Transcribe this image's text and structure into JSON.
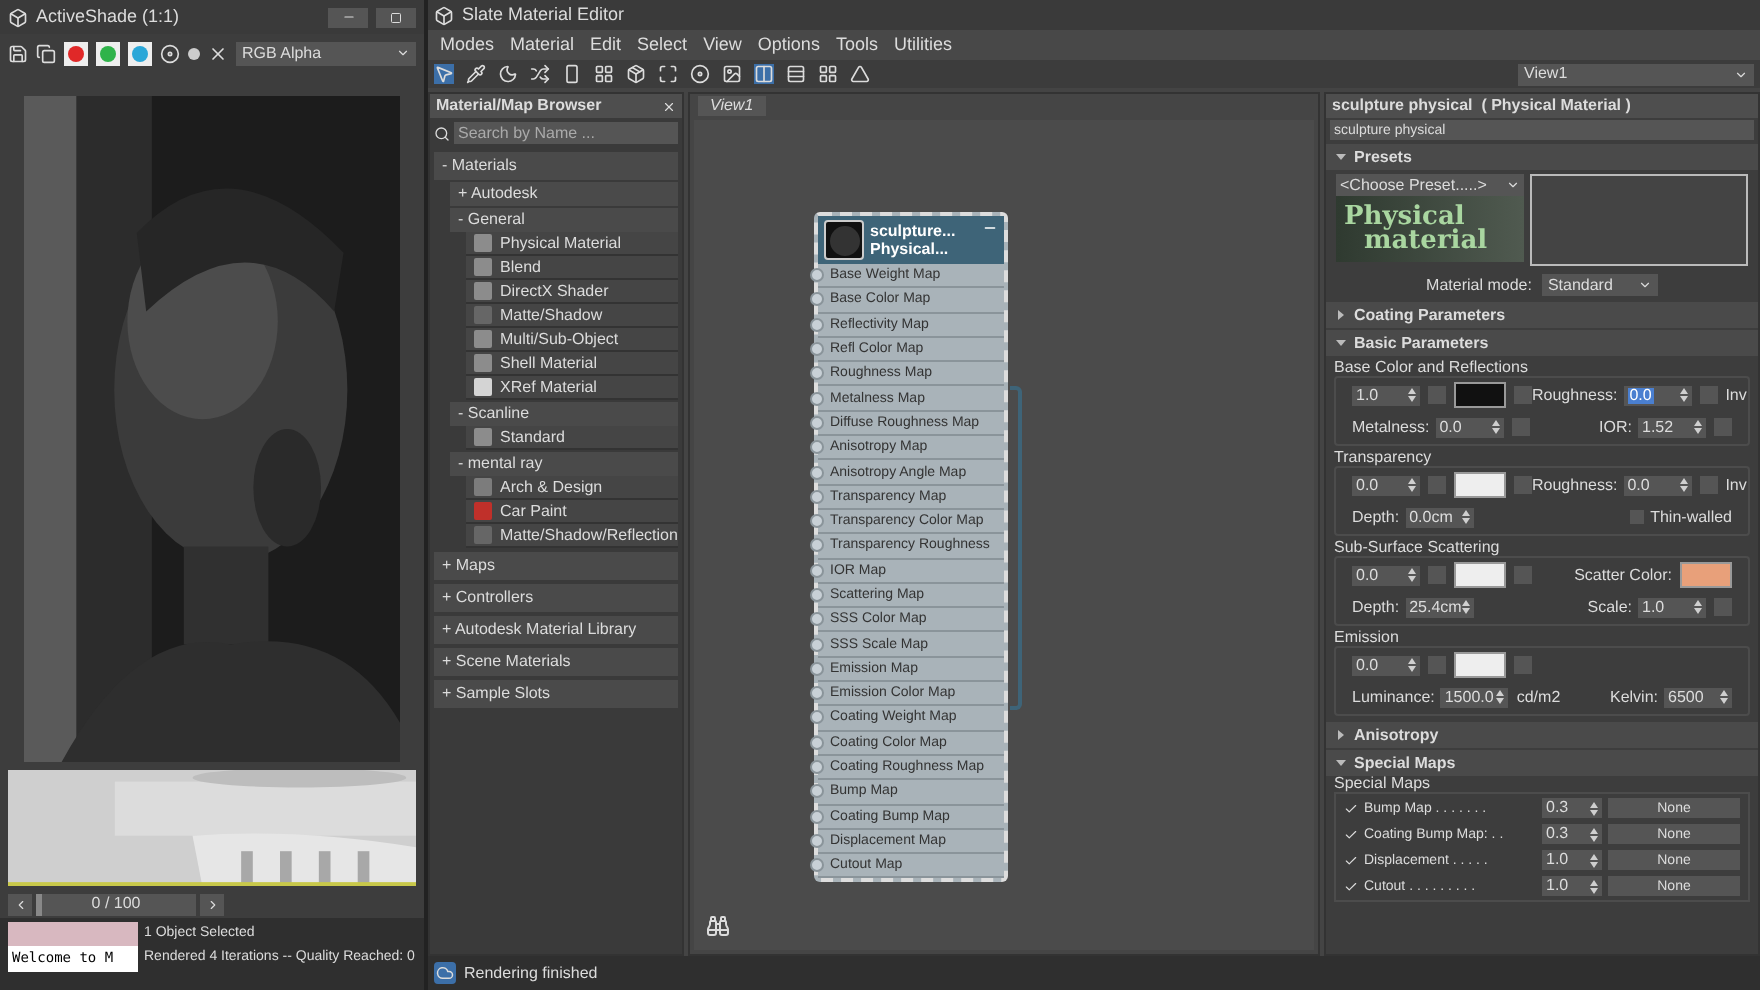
{
  "activeshade": {
    "title": "ActiveShade (1:1)",
    "channel_buttons": [
      {
        "color": "#e02828"
      },
      {
        "color": "#2fb34a"
      },
      {
        "color": "#2aa7d8"
      }
    ],
    "channel_dropdown": "RGB Alpha",
    "timeline": {
      "text": "0 / 100",
      "level": 0
    },
    "prompt": "Welcome to M",
    "status": [
      "1 Object Selected",
      "Rendered 4 Iterations -- Quality Reached: 0"
    ]
  },
  "editor": {
    "title": "Slate Material Editor",
    "menu": [
      "Modes",
      "Material",
      "Edit",
      "Select",
      "View",
      "Options",
      "Tools",
      "Utilities"
    ],
    "view_dropdown": "View1",
    "status": "Rendering finished"
  },
  "browser": {
    "title": "Material/Map Browser",
    "search": {
      "placeholder": "Search by Name ..."
    },
    "groups": [
      {
        "label": "- Materials",
        "children": [
          {
            "label": "+ Autodesk"
          },
          {
            "label": "- General",
            "children": [
              {
                "label": "Physical Material",
                "color": "#8c8c8c"
              },
              {
                "label": "Blend",
                "color": "#8c8c8c"
              },
              {
                "label": "DirectX Shader",
                "color": "#8c8c8c"
              },
              {
                "label": "Matte/Shadow",
                "color": "#666666"
              },
              {
                "label": "Multi/Sub-Object",
                "color": "#8c8c8c"
              },
              {
                "label": "Shell Material",
                "color": "#8c8c8c"
              },
              {
                "label": "XRef Material",
                "color": "#d4d4d4"
              }
            ]
          },
          {
            "label": "- Scanline",
            "children": [
              {
                "label": "Standard",
                "color": "#8c8c8c"
              }
            ]
          },
          {
            "label": "- mental ray",
            "children": [
              {
                "label": "Arch & Design",
                "color": "#7c7c7c"
              },
              {
                "label": "Car Paint",
                "color": "#c0302a"
              },
              {
                "label": "Matte/Shadow/Reflection",
                "color": "#666666"
              }
            ]
          }
        ]
      },
      {
        "label": "+ Maps"
      },
      {
        "label": "+ Controllers"
      },
      {
        "label": "+ Autodesk Material Library"
      },
      {
        "label": "+ Scene Materials"
      },
      {
        "label": "+ Sample Slots"
      }
    ]
  },
  "view": {
    "tab": "View1",
    "node": {
      "title": [
        "sculpture...",
        "Physical..."
      ],
      "slots": [
        "Base Weight Map",
        "Base Color Map",
        "Reflectivity Map",
        "Refl Color Map",
        "Roughness Map",
        "Metalness Map",
        "Diffuse Roughness Map",
        "Anisotropy Map",
        "Anisotropy Angle Map",
        "Transparency Map",
        "Transparency Color Map",
        "Transparency Roughness",
        "IOR Map",
        "Scattering Map",
        "SSS Color Map",
        "SSS Scale Map",
        "Emission Map",
        "Emission Color Map",
        "Coating Weight Map",
        "Coating Color Map",
        "Coating Roughness Map",
        "Bump Map",
        "Coating Bump Map",
        "Displacement Map",
        "Cutout Map"
      ]
    }
  },
  "params": {
    "title": "sculpture physical  ( Physical Material )",
    "name": "sculpture physical",
    "rollouts": [
      {
        "kind": "presets",
        "label": "Presets",
        "expanded": true,
        "preset": "<Choose Preset.....>",
        "logo": [
          "Physical",
          "material"
        ],
        "mode_label": "Material mode:",
        "mode": "Standard"
      },
      {
        "label": "Coating Parameters",
        "expanded": false
      },
      {
        "kind": "basic",
        "label": "Basic Parameters",
        "expanded": true,
        "groups": [
          {
            "title": "Base Color and Reflections",
            "rows": [
              {
                "left": [
                  {
                    "kind": "spin",
                    "value": "1.0",
                    "highlighted": false
                  },
                  {
                    "kind": "slot"
                  },
                  {
                    "kind": "swatch",
                    "color": "#111111"
                  },
                  {
                    "kind": "slot"
                  }
                ],
                "right": [
                  {
                    "kind": "spin",
                    "label": "Roughness:",
                    "value": "0.0",
                    "highlighted": true
                  },
                  {
                    "kind": "slot"
                  },
                  {
                    "kind": "text",
                    "text": "Inv"
                  }
                ]
              },
              {
                "left": [
                  {
                    "kind": "spin",
                    "label": "Metalness:",
                    "value": "0.0",
                    "highlighted": false
                  },
                  {
                    "kind": "slot"
                  }
                ],
                "right": [
                  {
                    "kind": "spin",
                    "label": "IOR:",
                    "value": "1.52",
                    "highlighted": false
                  },
                  {
                    "kind": "slot"
                  }
                ]
              }
            ]
          },
          {
            "title": "Transparency",
            "rows": [
              {
                "left": [
                  {
                    "kind": "spin",
                    "value": "0.0",
                    "highlighted": false
                  },
                  {
                    "kind": "slot"
                  },
                  {
                    "kind": "swatch",
                    "color": "#eeeeee"
                  },
                  {
                    "kind": "slot"
                  }
                ],
                "right": [
                  {
                    "kind": "spin",
                    "label": "Roughness:",
                    "value": "0.0",
                    "highlighted": false
                  },
                  {
                    "kind": "slot"
                  },
                  {
                    "kind": "text",
                    "text": "Inv"
                  }
                ]
              },
              {
                "left": [
                  {
                    "kind": "spin",
                    "label": "Depth:",
                    "value": "0.0cm",
                    "highlighted": false
                  }
                ],
                "right": [
                  {
                    "kind": "check",
                    "label": "Thin-walled",
                    "checked": false
                  }
                ]
              }
            ]
          },
          {
            "title": "Sub-Surface Scattering",
            "rows": [
              {
                "left": [
                  {
                    "kind": "spin",
                    "value": "0.0",
                    "highlighted": false
                  },
                  {
                    "kind": "slot"
                  },
                  {
                    "kind": "swatch",
                    "color": "#eeeeee"
                  },
                  {
                    "kind": "slot"
                  }
                ],
                "right": [
                  {
                    "kind": "text",
                    "text": "Scatter Color:"
                  },
                  {
                    "kind": "swatch",
                    "color": "#e8a07a"
                  }
                ]
              },
              {
                "left": [
                  {
                    "kind": "spin",
                    "label": "Depth:",
                    "value": "25.4cm",
                    "highlighted": false
                  }
                ],
                "right": [
                  {
                    "kind": "spin",
                    "label": "Scale:",
                    "value": "1.0",
                    "highlighted": false
                  },
                  {
                    "kind": "slot"
                  }
                ]
              }
            ]
          },
          {
            "title": "Emission",
            "rows": [
              {
                "left": [
                  {
                    "kind": "spin",
                    "value": "0.0",
                    "highlighted": false
                  },
                  {
                    "kind": "slot"
                  },
                  {
                    "kind": "swatch",
                    "color": "#eeeeee"
                  },
                  {
                    "kind": "slot"
                  }
                ],
                "right": []
              },
              {
                "left": [
                  {
                    "kind": "spin",
                    "label": "Luminance:",
                    "value": "1500.0",
                    "highlighted": false
                  },
                  {
                    "kind": "text",
                    "text": "cd/m2"
                  }
                ],
                "right": [
                  {
                    "kind": "spin",
                    "label": "Kelvin:",
                    "value": "6500",
                    "highlighted": false
                  }
                ]
              }
            ]
          }
        ]
      },
      {
        "label": "Anisotropy",
        "expanded": false
      },
      {
        "kind": "maps",
        "label": "Special Maps",
        "expanded": true,
        "group": "Special Maps",
        "rows": [
          {
            "checked": true,
            "label": "Bump Map . . . . . . .",
            "value": "0.3",
            "button": "None"
          },
          {
            "checked": true,
            "label": "Coating Bump Map: . .",
            "value": "0.3",
            "button": "None"
          },
          {
            "checked": true,
            "label": "Displacement . . . . .",
            "value": "1.0",
            "button": "None"
          },
          {
            "checked": true,
            "label": "Cutout . . . . . . . . .",
            "value": "1.0",
            "button": "None"
          }
        ]
      }
    ]
  }
}
